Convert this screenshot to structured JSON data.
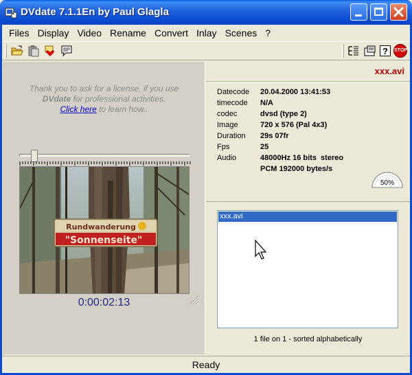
{
  "window": {
    "title": "DVdate 7.1.1En by Paul Glagla",
    "colors": {
      "title_bar": "#0b4bd0",
      "close": "#d0401c",
      "accent": "#316ac5",
      "filename": "#b00000",
      "timecode": "#1c2a88"
    }
  },
  "menu": {
    "items": [
      "Files",
      "Display",
      "Video",
      "Rename",
      "Convert",
      "Inlay",
      "Scenes",
      "?"
    ]
  },
  "toolbar": {
    "left_icons": [
      "open-folder-icon",
      "paste-icon",
      "favorite-icon",
      "comment-icon"
    ],
    "right_icons": [
      "properties-icon",
      "settings-icon",
      "help-icon",
      "stop-icon"
    ],
    "stop_label": "STOP",
    "help_label": "?"
  },
  "license": {
    "line1": "Thank you to ask for a license, if you use",
    "product": "DVdate",
    "line2_rest": " for professional activities.",
    "link": "Click here",
    "line3_rest": " to learn how.."
  },
  "player": {
    "timecode": "0:00:02:13",
    "position_fraction": 0.09,
    "sign_line1": "Rundwanderung",
    "sign_line2": "\"Sonnenseite\""
  },
  "info": {
    "filename": "xxx.avi",
    "rows": [
      {
        "key": "Datecode",
        "value": "20.04.2000 13:41:53"
      },
      {
        "key": "timecode",
        "value": "N/A"
      },
      {
        "key": "codec",
        "value": "dvsd (type 2)"
      },
      {
        "key": "Image",
        "value": "720 x 576 (Pal 4x3)"
      },
      {
        "key": "Duration",
        "value": "29s 07fr"
      },
      {
        "key": "Fps",
        "value": "25"
      },
      {
        "key": "Audio",
        "value": "48000Hz 16 bits  stereo"
      },
      {
        "key": "",
        "value": "PCM 192000 bytes/s"
      }
    ],
    "gauge_label": "50%"
  },
  "filelist": {
    "items": [
      "xxx.avi"
    ],
    "status": "1 file on 1 - sorted alphabetically"
  },
  "statusbar": {
    "text": "Ready"
  }
}
